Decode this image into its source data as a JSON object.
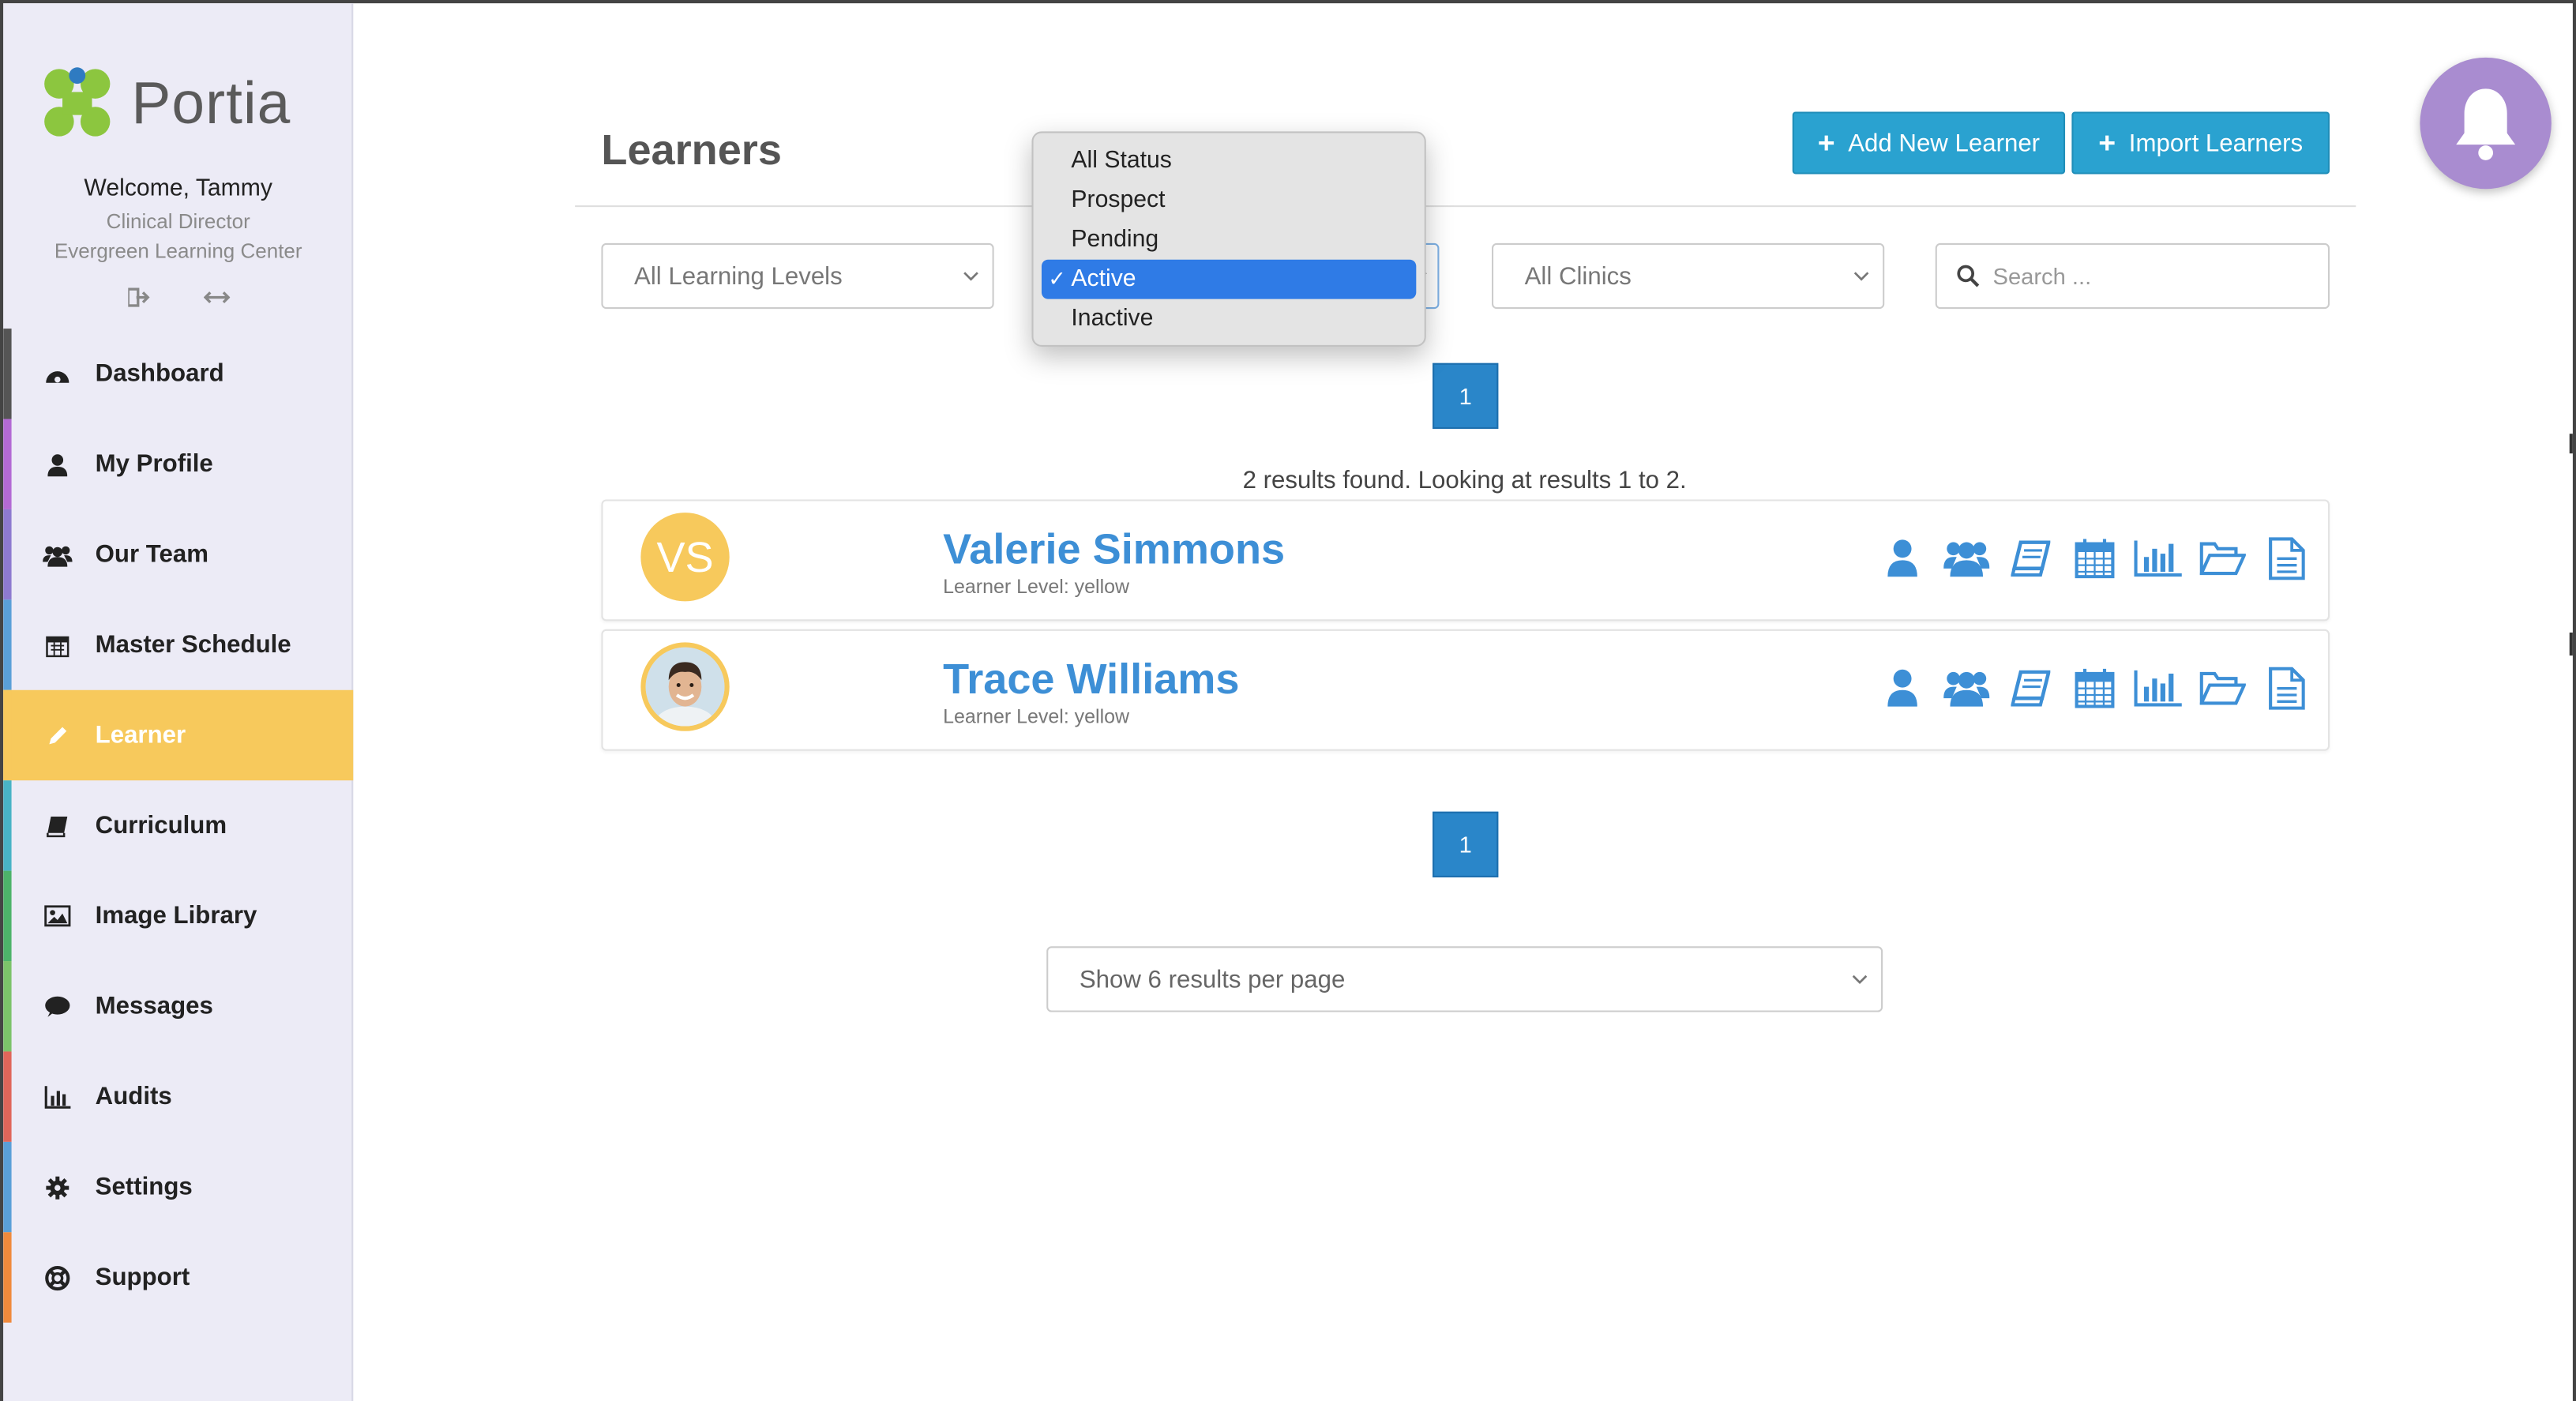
{
  "brand": {
    "name": "Portia"
  },
  "user": {
    "welcome": "Welcome, Tammy",
    "role": "Clinical Director",
    "organization": "Evergreen Learning Center"
  },
  "sidebar": {
    "items": [
      {
        "label": "Dashboard",
        "icon": "dashboard-icon",
        "color": "#555555"
      },
      {
        "label": "My Profile",
        "icon": "user-icon",
        "color": "#b36ad4"
      },
      {
        "label": "Our Team",
        "icon": "team-icon",
        "color": "#8e7ad0"
      },
      {
        "label": "Master Schedule",
        "icon": "calendar-icon",
        "color": "#5aa0d8"
      },
      {
        "label": "Learner",
        "icon": "pencil-icon",
        "color": "#f7c95c",
        "active": true
      },
      {
        "label": "Curriculum",
        "icon": "book-icon",
        "color": "#49b3c5"
      },
      {
        "label": "Image Library",
        "icon": "image-icon",
        "color": "#4db36a"
      },
      {
        "label": "Messages",
        "icon": "chat-icon",
        "color": "#7cc36a"
      },
      {
        "label": "Audits",
        "icon": "bar-chart-icon",
        "color": "#e0665a"
      },
      {
        "label": "Settings",
        "icon": "gear-icon",
        "color": "#5aa0d8"
      },
      {
        "label": "Support",
        "icon": "life-ring-icon",
        "color": "#f08a3c"
      }
    ]
  },
  "main": {
    "title": "Learners",
    "add_button": "Add New Learner",
    "import_button": "Import Learners",
    "filters": {
      "learning_levels": "All Learning Levels",
      "clinics": "All Clinics",
      "search_placeholder": "Search ..."
    },
    "status_dropdown": {
      "options": [
        "All Status",
        "Prospect",
        "Pending",
        "Active",
        "Inactive"
      ],
      "selected": "Active"
    },
    "pagination": {
      "page": "1"
    },
    "results_text": "2 results found. Looking at results 1 to 2.",
    "learners": [
      {
        "initials": "VS",
        "name": "Valerie Simmons",
        "level": "Learner Level: yellow"
      },
      {
        "name": "Trace Williams",
        "level": "Learner Level: yellow"
      }
    ],
    "per_page": "Show 6 results per page"
  },
  "colors": {
    "accent_blue": "#2aa2d0",
    "link_blue": "#3d8fd6",
    "active_yellow": "#f7c95c",
    "bell_purple": "#a98cd0"
  }
}
